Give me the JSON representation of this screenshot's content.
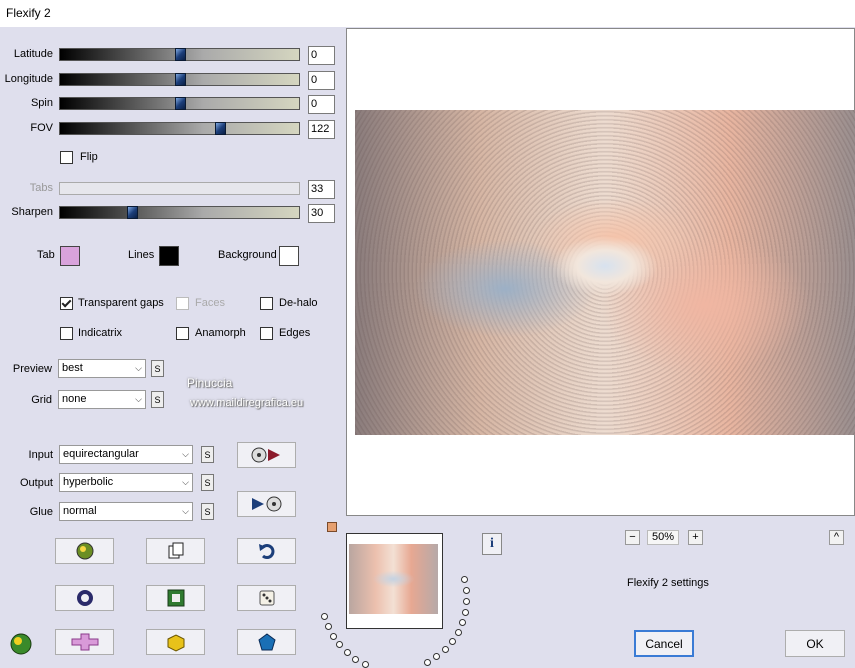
{
  "window": {
    "title": "Flexify 2"
  },
  "sliders": [
    {
      "label": "Latitude",
      "value": "0",
      "level": 0.5,
      "enabled": true
    },
    {
      "label": "Longitude",
      "value": "0",
      "level": 0.5,
      "enabled": true
    },
    {
      "label": "Spin",
      "value": "0",
      "level": 0.5,
      "enabled": true
    },
    {
      "label": "FOV",
      "value": "122",
      "level": 0.67,
      "enabled": true
    },
    {
      "label": "Tabs",
      "value": "33",
      "level": 0.0,
      "enabled": false
    },
    {
      "label": "Sharpen",
      "value": "30",
      "level": 0.3,
      "enabled": true
    }
  ],
  "flip": {
    "label": "Flip",
    "checked": false
  },
  "colors": {
    "tab": {
      "label": "Tab",
      "color": "#d9a3dc"
    },
    "lines": {
      "label": "Lines",
      "color": "#000000"
    },
    "background": {
      "label": "Background",
      "color": "#ffffff"
    }
  },
  "options": {
    "transparent_gaps": {
      "label": "Transparent gaps",
      "checked": true
    },
    "faces": {
      "label": "Faces",
      "checked": false,
      "enabled": false
    },
    "de_halo": {
      "label": "De-halo",
      "checked": false
    },
    "indicatrix": {
      "label": "Indicatrix",
      "checked": false
    },
    "anamorph": {
      "label": "Anamorph",
      "checked": false
    },
    "edges": {
      "label": "Edges",
      "checked": false
    }
  },
  "preview": {
    "label": "Preview",
    "value": "best"
  },
  "grid": {
    "label": "Grid",
    "value": "none"
  },
  "input": {
    "label": "Input",
    "value": "equirectangular"
  },
  "output": {
    "label": "Output",
    "value": "hyperbolic"
  },
  "glue": {
    "label": "Glue",
    "value": "normal"
  },
  "s_label": "S",
  "watermark": {
    "line1": "Pinuccia",
    "line2": "www.maildiregrafica.eu"
  },
  "zoom": {
    "minus": "−",
    "value": "50%",
    "plus": "+"
  },
  "collapse": "^",
  "info": "i",
  "settings_text": "Flexify 2 settings",
  "cancel": "Cancel",
  "ok": "OK"
}
